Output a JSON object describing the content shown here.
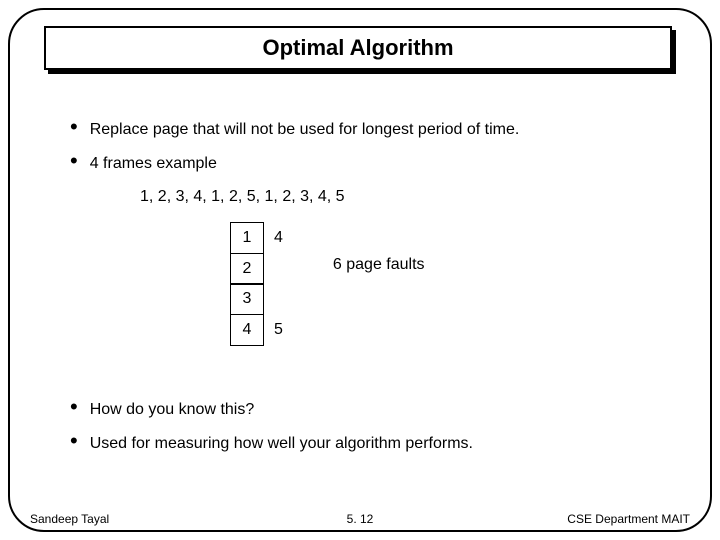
{
  "title": "Optimal Algorithm",
  "bullets": {
    "b1": "Replace page that will not be used for longest period of time.",
    "b2": "4 frames example",
    "b3": "How do you know this?",
    "b4": "Used for measuring how well your algorithm performs."
  },
  "reference_string": "1, 2, 3, 4, 1, 2, 5, 1, 2, 3, 4, 5",
  "frames": {
    "c1": "1",
    "c2": "2",
    "c3": "3",
    "c4": "4"
  },
  "side": {
    "s1": "4",
    "s2": "",
    "s3": "",
    "s4": "5"
  },
  "faults_label": "6 page faults",
  "footer": {
    "left": "Sandeep Tayal",
    "center": "5. 12",
    "right": "CSE Department MAIT"
  }
}
